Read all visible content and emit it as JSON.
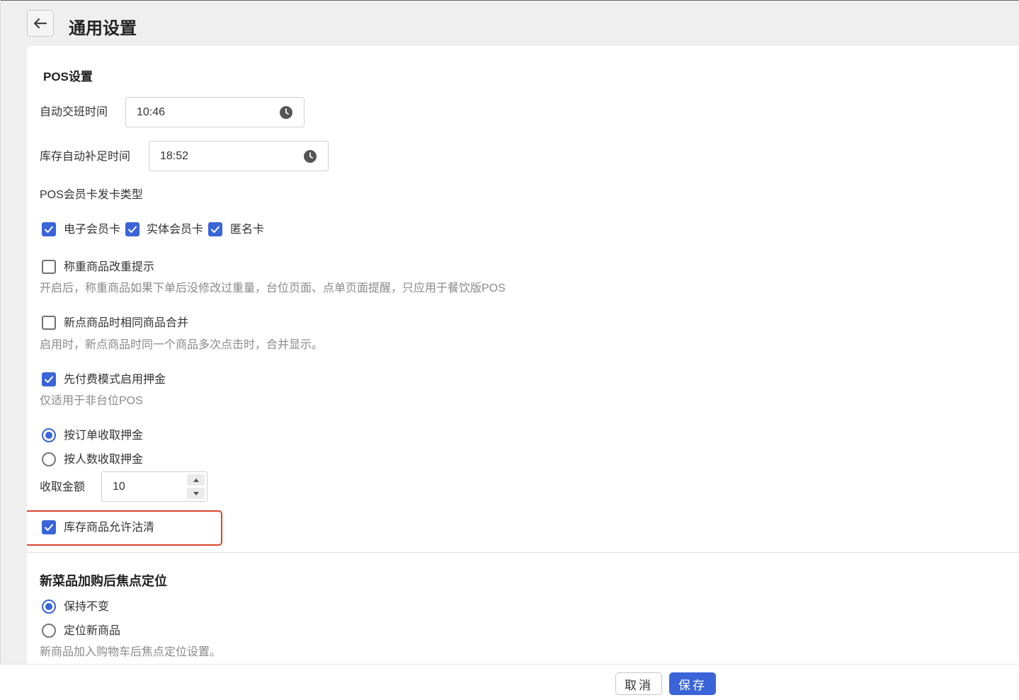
{
  "header": {
    "title": "通用设置",
    "back_icon": "arrow-left-icon"
  },
  "pos": {
    "title": "POS设置",
    "auto_shift": {
      "label": "自动交班时间",
      "value": "10:46"
    },
    "auto_restock": {
      "label": "库存自动补足时间",
      "value": "18:52"
    },
    "card_types": {
      "label": "POS会员卡发卡类型",
      "options": [
        {
          "label": "电子会员卡",
          "checked": true
        },
        {
          "label": "实体会员卡",
          "checked": true
        },
        {
          "label": "匿名卡",
          "checked": true
        }
      ]
    },
    "weigh_prompt": {
      "label": "称重商品改重提示",
      "checked": false,
      "hint": "开启后，称重商品如果下单后没修改过重量，台位页面、点单页面提醒，只应用于餐饮版POS"
    },
    "merge_same": {
      "label": "新点商品时相同商品合并",
      "checked": false,
      "hint": "启用时，新点商品时同一个商品多次点击时，合并显示。"
    },
    "prepay_deposit": {
      "label": "先付费模式启用押金",
      "checked": true,
      "hint": "仅适用于非台位POS"
    },
    "deposit_modes": [
      {
        "label": "按订单收取押金",
        "selected": true
      },
      {
        "label": "按人数收取押金",
        "selected": false
      }
    ],
    "amount": {
      "label": "收取金额",
      "value": "10"
    },
    "allow_selloff": {
      "label": "库存商品允许沽清",
      "checked": true
    }
  },
  "focus": {
    "title": "新菜品加购后焦点定位",
    "options": [
      {
        "label": "保持不变",
        "selected": true
      },
      {
        "label": "定位新商品",
        "selected": false
      }
    ],
    "hint": "新商品加入购物车后焦点定位设置。"
  },
  "footer": {
    "cancel_label": "取消",
    "save_label": "保存"
  },
  "colors": {
    "accent": "#3a64d8",
    "highlight_border": "#d9452b"
  }
}
